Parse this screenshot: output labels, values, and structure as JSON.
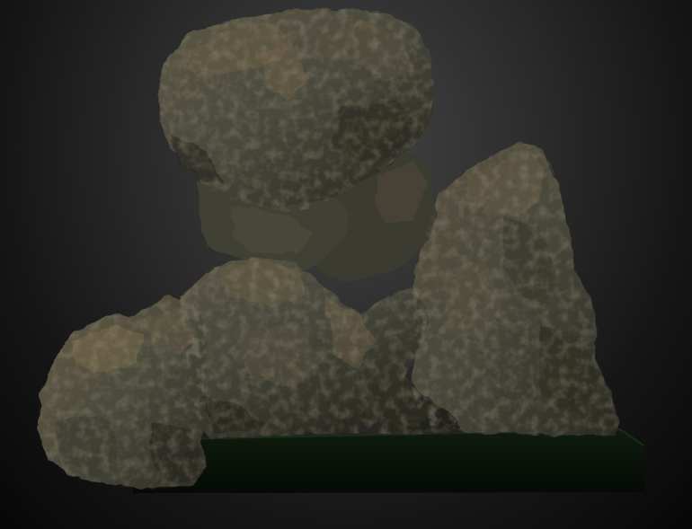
{
  "scene": {
    "subject": "rock-formation",
    "background_color": "#202020",
    "rock_base_color": "#4a4a3d",
    "rock_highlight_color": "#7a6a4c",
    "rock_shadow_color": "#1d1d18",
    "pedestal_color": "#0d170d"
  }
}
